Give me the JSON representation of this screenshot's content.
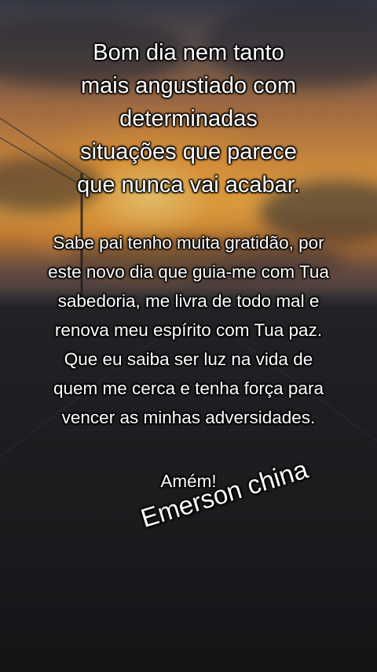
{
  "heading": {
    "lines": [
      "Bom dia nem tanto",
      "mais angustiado com",
      "determinadas",
      "situações que parece",
      "que nunca vai acabar."
    ]
  },
  "paragraph": {
    "lines": [
      "Sabe pai tenho muita gratidão, por",
      "este novo dia que guia-me com Tua",
      "sabedoria, me livra de todo mal e",
      "renova meu espírito com Tua paz.",
      "Que eu saiba ser luz na vida de",
      "quem me cerca e tenha força para",
      "vencer as minhas adversidades."
    ]
  },
  "amen": "Amém!",
  "signature": "Emerson china",
  "colors": {
    "text": "#ffffff",
    "sun_glow": "#f2b24c",
    "sky_top": "#3c3f4d",
    "ground": "#1b1c1f"
  }
}
